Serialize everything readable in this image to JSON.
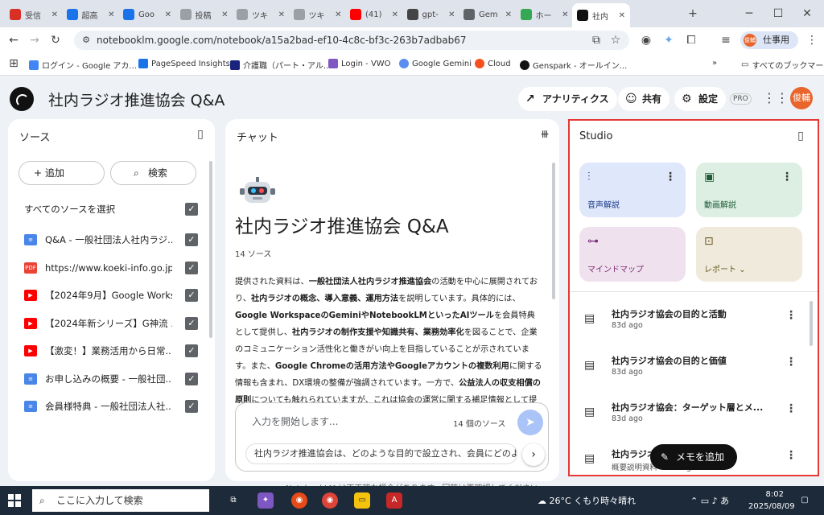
{
  "tabs": [
    {
      "label": "受信",
      "color": "#d93025"
    },
    {
      "label": "超高",
      "color": "#1a73e8"
    },
    {
      "label": "Goo",
      "color": "#1a73e8"
    },
    {
      "label": "投稿",
      "color": "#9aa0a6"
    },
    {
      "label": "ツキ",
      "color": "#9aa0a6"
    },
    {
      "label": "ツキ",
      "color": "#9aa0a6"
    },
    {
      "label": "(41)",
      "color": "#ff0000"
    },
    {
      "label": "gpt-",
      "color": "#444444"
    },
    {
      "label": "Gem",
      "color": "#5f6368"
    },
    {
      "label": "ホー",
      "color": "#34a853"
    },
    {
      "label": "社内",
      "color": "#111111"
    }
  ],
  "new_tab_icon": "plus-icon",
  "url": "notebooklm.google.com/notebook/a15a2bad-ef10-4c8c-bf3c-263b7adbab67",
  "profile": {
    "label": "仕事用",
    "avatar": "俊輔"
  },
  "bookmarks": [
    "ログイン - Google アカ...",
    "PageSpeed Insights",
    "介護職（パート・アル...",
    "Login - VWO",
    "Google Gemini",
    "Cloud",
    "Genspark - オールイン..."
  ],
  "bookmarks_more": "»",
  "all_bookmarks": "すべてのブックマーク",
  "app": {
    "title": "社内ラジオ推進協会 Q&A",
    "analytics": "アナリティクス",
    "share": "共有",
    "settings": "設定",
    "pro": "PRO",
    "avatar": "俊輔"
  },
  "sources": {
    "title": "ソース",
    "add": "追加",
    "search": "検索",
    "select_all": "すべてのソースを選択",
    "items": [
      {
        "label": "Q&A - 一般社団法人社内ラジ...",
        "type": "doc"
      },
      {
        "label": "https://www.koeki-info.go.jp/...",
        "type": "pdf"
      },
      {
        "label": "【2024年9月】Google Works...",
        "type": "youtube"
      },
      {
        "label": "【2024年新シリーズ】G神流 ...",
        "type": "youtube"
      },
      {
        "label": "【激変！】業務活用から日常...",
        "type": "youtube"
      },
      {
        "label": "お申し込みの概要 - 一般社団...",
        "type": "doc"
      },
      {
        "label": "会員様特典 - 一般社団法人社...",
        "type": "doc"
      }
    ]
  },
  "chat": {
    "title": "チャット",
    "notebook_title": "社内ラジオ推進協会 Q&A",
    "source_count": "14 ソース",
    "summary_html": "提供された資料は、<b>一般社団法人社内ラジオ推進協会</b>の活動を中心に展開されており、<b>社内ラジオの概念、導入意義、運用方法</b>を説明しています。具体的には、<b>Google WorkspaceのGeminiやNotebookLMといったAIツール</b>を会員特典として提供し、<b>社内ラジオの制作支援や知識共有、業務効率化</b>を図ることで、企業のコミュニケーション活性化と働きがい向上を目指していることが示されています。また、<b>Google Chromeの活用方法やGoogleアカウントの複数利用</b>に関する情報も含まれ、DX環境の整備が強調されています。一方で、<b>公益法人の収支相償の原則</b>についても触れられていますが、これは協会の運営に関する補足情報として提示されています。",
    "input_placeholder": "入力を開始します...",
    "input_sources": "14 個のソース",
    "suggestion": "社内ラジオ推進協会は、どのような目的で設立され、会員にどのよ",
    "footer": "NotebookLM は不正確な場合があります。回答は再確認してください。"
  },
  "studio": {
    "title": "Studio",
    "cards": [
      {
        "label": "音声解説",
        "icon": "waveform-icon",
        "bg": "#dfe7fa",
        "color": "#1a3a8a"
      },
      {
        "label": "動画解説",
        "icon": "video-icon",
        "bg": "#dcefe2",
        "color": "#1e5b36"
      },
      {
        "label": "マインドマップ",
        "icon": "mindmap-icon",
        "bg": "#efe2ee",
        "color": "#7a2b73"
      },
      {
        "label": "レポート",
        "icon": "report-icon",
        "bg": "#efeadb",
        "color": "#6b5a23"
      }
    ],
    "notes": [
      {
        "title": "社内ラジオ協会の目的と活動",
        "sub": "83d ago"
      },
      {
        "title": "社内ラジオ協会の目的と価値",
        "sub": "83d ago"
      },
      {
        "title": "社内ラジオ協会：ターゲット層とメ...",
        "sub": "83d ago"
      },
      {
        "title": "社内ラジオ協会 - 活用",
        "sub": "概要説明資料 · 83d ago"
      }
    ],
    "add_note": "メモを追加"
  },
  "taskbar": {
    "search": "ここに入力して検索",
    "weather": "26°C  くもり時々晴れ",
    "ime": "あ",
    "time": "8:02",
    "date": "2025/08/09"
  }
}
